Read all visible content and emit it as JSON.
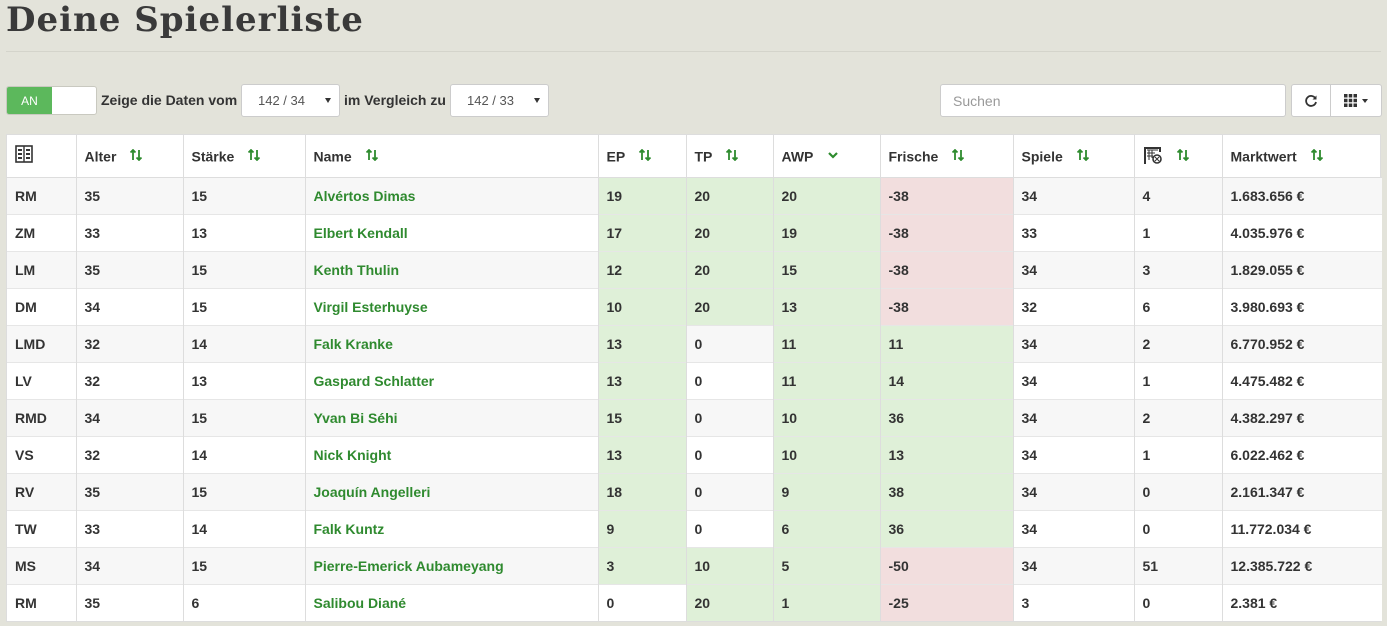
{
  "page": {
    "title": "Deine Spielerliste"
  },
  "toolbar": {
    "toggle_label": "AN",
    "label_from": "Zeige die Daten vom",
    "from_value": "142 / 34",
    "label_compare": "im Vergleich zu",
    "compare_value": "142 / 33",
    "search_placeholder": "Suchen"
  },
  "colors": {
    "accent": "#5cb85c",
    "link": "#2f8a2f",
    "good": "#dff0d8",
    "bad": "#f2dede"
  },
  "table": {
    "headers": {
      "position_icon": "formation-icon",
      "alter": "Alter",
      "staerke": "Stärke",
      "name": "Name",
      "ep": "EP",
      "tp": "TP",
      "awp": "AWP",
      "frische": "Frische",
      "spiele": "Spiele",
      "tore_icon": "goal-icon",
      "marktwert": "Marktwert"
    },
    "sorted_column": "awp",
    "rows": [
      {
        "pos": "RM",
        "alter": "35",
        "staerke": "15",
        "name": "Alvértos Dimas",
        "ep": "19",
        "tp": "20",
        "awp": "20",
        "frische": "-38",
        "spiele": "34",
        "tore": "4",
        "marktwert": "1.683.656 €"
      },
      {
        "pos": "ZM",
        "alter": "33",
        "staerke": "13",
        "name": "Elbert Kendall",
        "ep": "17",
        "tp": "20",
        "awp": "19",
        "frische": "-38",
        "spiele": "33",
        "tore": "1",
        "marktwert": "4.035.976 €"
      },
      {
        "pos": "LM",
        "alter": "35",
        "staerke": "15",
        "name": "Kenth Thulin",
        "ep": "12",
        "tp": "20",
        "awp": "15",
        "frische": "-38",
        "spiele": "34",
        "tore": "3",
        "marktwert": "1.829.055 €"
      },
      {
        "pos": "DM",
        "alter": "34",
        "staerke": "15",
        "name": "Virgil Esterhuyse",
        "ep": "10",
        "tp": "20",
        "awp": "13",
        "frische": "-38",
        "spiele": "32",
        "tore": "6",
        "marktwert": "3.980.693 €"
      },
      {
        "pos": "LMD",
        "alter": "32",
        "staerke": "14",
        "name": "Falk Kranke",
        "ep": "13",
        "tp": "0",
        "awp": "11",
        "frische": "11",
        "spiele": "34",
        "tore": "2",
        "marktwert": "6.770.952 €"
      },
      {
        "pos": "LV",
        "alter": "32",
        "staerke": "13",
        "name": "Gaspard Schlatter",
        "ep": "13",
        "tp": "0",
        "awp": "11",
        "frische": "14",
        "spiele": "34",
        "tore": "1",
        "marktwert": "4.475.482 €"
      },
      {
        "pos": "RMD",
        "alter": "34",
        "staerke": "15",
        "name": "Yvan Bi Séhi",
        "ep": "15",
        "tp": "0",
        "awp": "10",
        "frische": "36",
        "spiele": "34",
        "tore": "2",
        "marktwert": "4.382.297 €"
      },
      {
        "pos": "VS",
        "alter": "32",
        "staerke": "14",
        "name": "Nick Knight",
        "ep": "13",
        "tp": "0",
        "awp": "10",
        "frische": "13",
        "spiele": "34",
        "tore": "1",
        "marktwert": "6.022.462 €"
      },
      {
        "pos": "RV",
        "alter": "35",
        "staerke": "15",
        "name": "Joaquín Angelleri",
        "ep": "18",
        "tp": "0",
        "awp": "9",
        "frische": "38",
        "spiele": "34",
        "tore": "0",
        "marktwert": "2.161.347 €"
      },
      {
        "pos": "TW",
        "alter": "33",
        "staerke": "14",
        "name": "Falk Kuntz",
        "ep": "9",
        "tp": "0",
        "awp": "6",
        "frische": "36",
        "spiele": "34",
        "tore": "0",
        "marktwert": "11.772.034 €"
      },
      {
        "pos": "MS",
        "alter": "34",
        "staerke": "15",
        "name": "Pierre-Emerick Aubameyang",
        "ep": "3",
        "tp": "10",
        "awp": "5",
        "frische": "-50",
        "spiele": "34",
        "tore": "51",
        "marktwert": "12.385.722 €"
      },
      {
        "pos": "RM",
        "alter": "35",
        "staerke": "6",
        "name": "Salibou Diané",
        "ep": "0",
        "tp": "20",
        "awp": "1",
        "frische": "-25",
        "spiele": "3",
        "tore": "0",
        "marktwert": "2.381 €"
      }
    ],
    "highlights": [
      {
        "ep": "good",
        "tp": "good",
        "awp": "good",
        "frische": "bad"
      },
      {
        "ep": "good",
        "tp": "good",
        "awp": "good",
        "frische": "bad"
      },
      {
        "ep": "good",
        "tp": "good",
        "awp": "good",
        "frische": "bad"
      },
      {
        "ep": "good",
        "tp": "good",
        "awp": "good",
        "frische": "bad"
      },
      {
        "ep": "good",
        "tp": "",
        "awp": "good",
        "frische": "good"
      },
      {
        "ep": "good",
        "tp": "",
        "awp": "good",
        "frische": "good"
      },
      {
        "ep": "good",
        "tp": "",
        "awp": "good",
        "frische": "good"
      },
      {
        "ep": "good",
        "tp": "",
        "awp": "good",
        "frische": "good"
      },
      {
        "ep": "good",
        "tp": "",
        "awp": "good",
        "frische": "good"
      },
      {
        "ep": "good",
        "tp": "",
        "awp": "good",
        "frische": "good"
      },
      {
        "ep": "good",
        "tp": "good",
        "awp": "good",
        "frische": "bad"
      },
      {
        "ep": "",
        "tp": "good",
        "awp": "good",
        "frische": "bad"
      }
    ]
  }
}
